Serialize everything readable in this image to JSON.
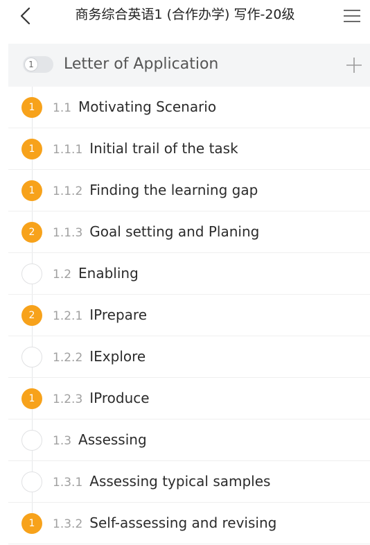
{
  "header": {
    "title": "商务综合英语1 (合作办学) 写作-20级"
  },
  "section": {
    "badge": "1",
    "title": "Letter of Application"
  },
  "items": [
    {
      "number": "1.1",
      "title": "Motivating Scenario",
      "badge": "1",
      "filled": true
    },
    {
      "number": "1.1.1",
      "title": "Initial trail of the task",
      "badge": "1",
      "filled": true
    },
    {
      "number": "1.1.2",
      "title": "Finding the learning gap",
      "badge": "1",
      "filled": true
    },
    {
      "number": "1.1.3",
      "title": "Goal setting and Planing",
      "badge": "2",
      "filled": true
    },
    {
      "number": "1.2",
      "title": "Enabling",
      "badge": "",
      "filled": false
    },
    {
      "number": "1.2.1",
      "title": "IPrepare",
      "badge": "2",
      "filled": true
    },
    {
      "number": "1.2.2",
      "title": "IExplore",
      "badge": "",
      "filled": false
    },
    {
      "number": "1.2.3",
      "title": "IProduce",
      "badge": "1",
      "filled": true
    },
    {
      "number": "1.3",
      "title": "Assessing",
      "badge": "",
      "filled": false
    },
    {
      "number": "1.3.1",
      "title": "Assessing typical samples",
      "badge": "",
      "filled": false
    },
    {
      "number": "1.3.2",
      "title": "Self-assessing and revising",
      "badge": "1",
      "filled": true
    }
  ],
  "colors": {
    "badge_filled": "#f7a21b",
    "section_bg": "#f4f5f6"
  },
  "icons": {
    "back": "chevron-left-icon",
    "menu": "hamburger-menu-icon",
    "add": "plus-icon"
  }
}
